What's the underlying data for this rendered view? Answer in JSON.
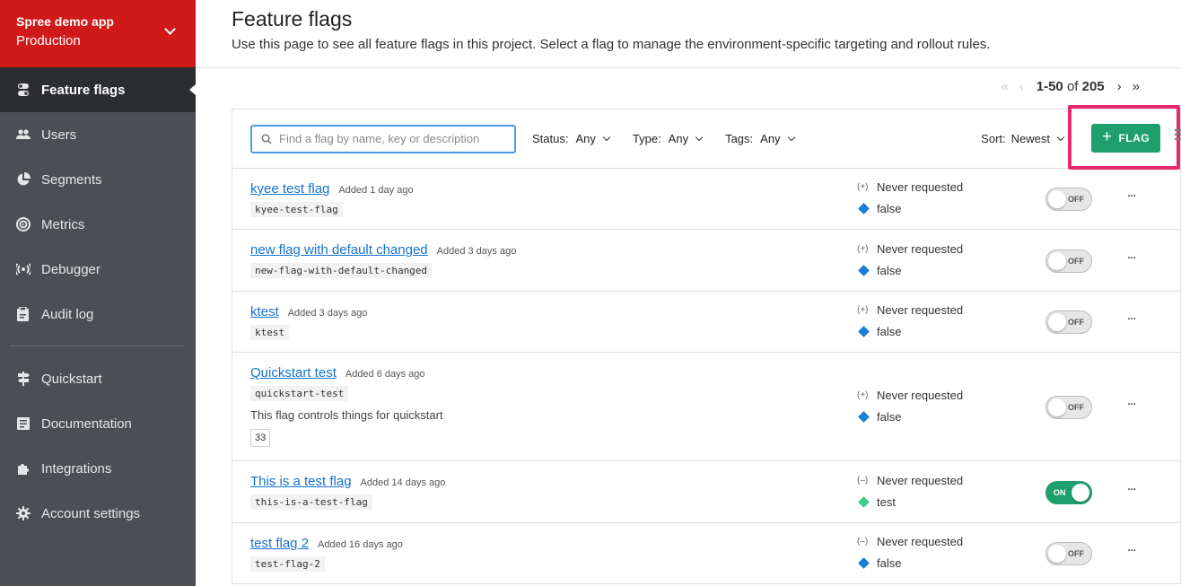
{
  "project": {
    "name": "Spree demo app",
    "environment": "Production"
  },
  "sidebar": {
    "items": [
      {
        "label": "Feature flags",
        "icon": "toggle-icon",
        "active": true
      },
      {
        "label": "Users",
        "icon": "users-icon"
      },
      {
        "label": "Segments",
        "icon": "pie-chart-icon"
      },
      {
        "label": "Metrics",
        "icon": "target-icon"
      },
      {
        "label": "Debugger",
        "icon": "radio-waves-icon"
      },
      {
        "label": "Audit log",
        "icon": "clipboard-icon"
      }
    ],
    "secondary": [
      {
        "label": "Quickstart",
        "icon": "signpost-icon"
      },
      {
        "label": "Documentation",
        "icon": "document-icon"
      },
      {
        "label": "Integrations",
        "icon": "puzzle-icon"
      },
      {
        "label": "Account settings",
        "icon": "gear-icon"
      }
    ]
  },
  "header": {
    "title": "Feature flags",
    "subtitle": "Use this page to see all feature flags in this project. Select a flag to manage the environment-specific targeting and rollout rules."
  },
  "pager": {
    "range": "1-50",
    "of": "of",
    "total": "205"
  },
  "toolbar": {
    "search_placeholder": "Find a flag by name, key or description",
    "status_label": "Status:",
    "status_value": "Any",
    "type_label": "Type:",
    "type_value": "Any",
    "tags_label": "Tags:",
    "tags_value": "Any",
    "sort_label": "Sort:",
    "sort_value": "Newest",
    "add_label": "FLAG"
  },
  "flags": [
    {
      "name": "kyee test flag",
      "added": "Added 1 day ago",
      "key": "kyee-test-flag",
      "glyph": "(+)",
      "requested": "Never requested",
      "value": "false",
      "value_color": "#1a7ed6",
      "toggle": "OFF"
    },
    {
      "name": "new flag with default changed",
      "added": "Added 3 days ago",
      "key": "new-flag-with-default-changed",
      "glyph": "(+)",
      "requested": "Never requested",
      "value": "false",
      "value_color": "#1a7ed6",
      "toggle": "OFF"
    },
    {
      "name": "ktest",
      "added": "Added 3 days ago",
      "key": "ktest",
      "glyph": "(+)",
      "requested": "Never requested",
      "value": "false",
      "value_color": "#1a7ed6",
      "toggle": "OFF"
    },
    {
      "name": "Quickstart test",
      "added": "Added 6 days ago",
      "key": "quickstart-test",
      "description": "This flag controls things for quickstart",
      "badge": "33",
      "glyph": "(+)",
      "requested": "Never requested",
      "value": "false",
      "value_color": "#1a7ed6",
      "toggle": "OFF"
    },
    {
      "name": "This is a test flag",
      "added": "Added 14 days ago",
      "key": "this-is-a-test-flag",
      "glyph": "(–)",
      "requested": "Never requested",
      "value": "test",
      "value_color": "#3ecf8e",
      "toggle": "ON"
    },
    {
      "name": "test flag 2",
      "added": "Added 16 days ago",
      "key": "test-flag-2",
      "glyph": "(–)",
      "requested": "Never requested",
      "value": "false",
      "value_color": "#1a7ed6",
      "toggle": "OFF"
    }
  ]
}
